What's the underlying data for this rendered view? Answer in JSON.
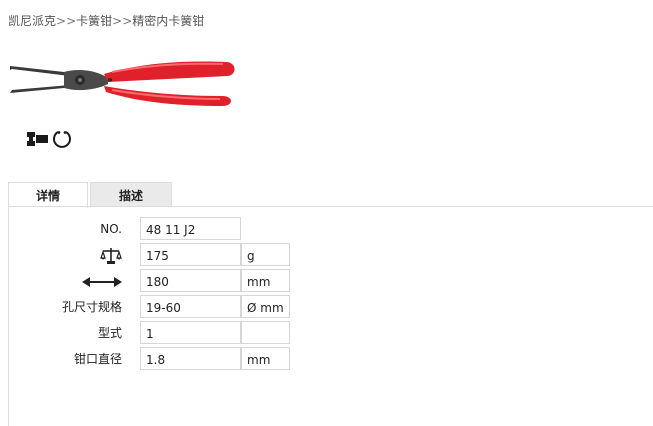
{
  "breadcrumb": {
    "items": [
      "凯尼派克",
      "卡簧钳",
      "精密内卡簧钳"
    ],
    "separator": ">>"
  },
  "product": {
    "image_icon": "circlip-pliers-image",
    "handle_color": "#e0202a",
    "feature_icons": [
      "circlip-symbol-icon",
      "ring-symbol-icon"
    ]
  },
  "tabs": [
    {
      "label": "详情",
      "active": true
    },
    {
      "label": "描述",
      "active": false
    }
  ],
  "specs": {
    "no": {
      "label": "NO.",
      "value": "48 11 J2"
    },
    "weight": {
      "label_icon": "scale-icon",
      "value": "175",
      "unit": "g"
    },
    "length": {
      "label_icon": "length-arrow-icon",
      "value": "180",
      "unit": "mm"
    },
    "hole_size": {
      "label": "孔尺寸规格",
      "value": "19-60",
      "unit": "Ø mm"
    },
    "type": {
      "label": "型式",
      "value": "1",
      "unit": ""
    },
    "tip_diameter": {
      "label": "钳口直径",
      "value": "1.8",
      "unit": "mm"
    }
  }
}
